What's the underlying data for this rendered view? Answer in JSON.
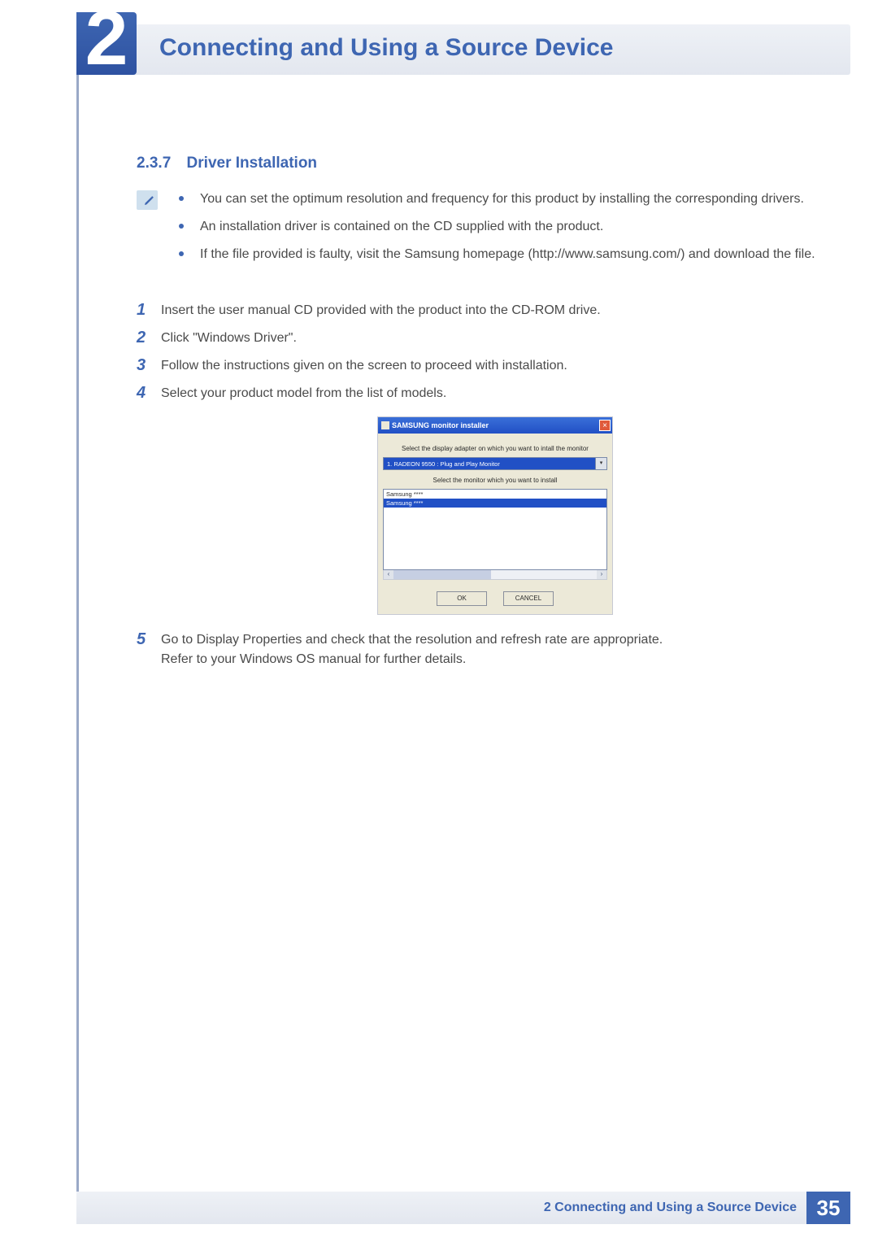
{
  "chapter": {
    "number": "2",
    "title": "Connecting and Using a Source Device"
  },
  "section": {
    "number": "2.3.7",
    "title": "Driver Installation"
  },
  "notes": [
    "You can set the optimum resolution and frequency for this product by installing the corresponding drivers.",
    "An installation driver is contained on the CD supplied with the product.",
    "If the file provided is faulty, visit the Samsung homepage (http://www.samsung.com/) and download the file."
  ],
  "steps": {
    "s1": {
      "n": "1",
      "text": "Insert the user manual CD provided with the product into the CD-ROM drive."
    },
    "s2": {
      "n": "2",
      "text": "Click \"Windows Driver\"."
    },
    "s3": {
      "n": "3",
      "text": "Follow the instructions given on the screen to proceed with installation."
    },
    "s4": {
      "n": "4",
      "text": "Select your product model from the list of models."
    },
    "s5": {
      "n": "5",
      "text": "Go to Display Properties and check that the resolution and refresh rate are appropriate.",
      "text2": "Refer to your Windows OS manual for further details."
    }
  },
  "dialog": {
    "title": "SAMSUNG monitor installer",
    "label_adapter": "Select the display adapter on which you want to intall the monitor",
    "adapter_value": "1. RADEON 9550 : Plug and Play Monitor",
    "label_monitor": "Select the monitor which you want to install",
    "list_item_a": "Samsung ****",
    "list_item_b": "Samsung ****",
    "btn_ok": "OK",
    "btn_cancel": "CANCEL"
  },
  "footer": {
    "label": "2 Connecting and Using a Source Device",
    "page": "35"
  }
}
